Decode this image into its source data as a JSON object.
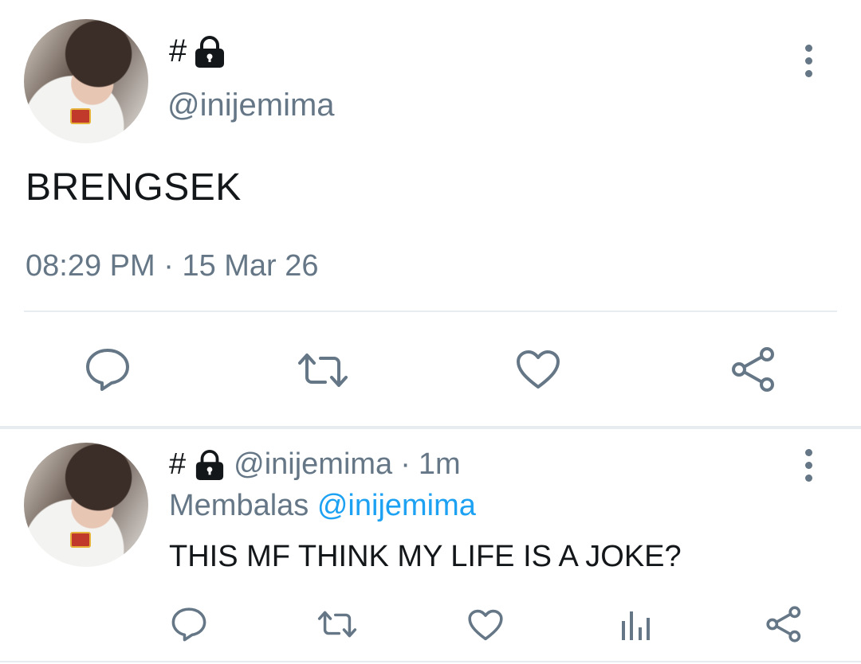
{
  "main_tweet": {
    "display_name": "#",
    "handle": "@inijemima",
    "text": "BRENGSEK",
    "time": "08:29 PM",
    "separator": "·",
    "date": "15 Mar 26"
  },
  "reply_tweet": {
    "display_name": "#",
    "handle": "@inijemima",
    "separator": "·",
    "time_ago": "1m",
    "replying_prefix": "Membalas",
    "replying_to": "@inijemima",
    "text": "THIS MF THINK MY LIFE IS A JOKE?"
  },
  "icons": {
    "lock": "lock-icon",
    "more": "more-vertical-icon",
    "reply": "reply-icon",
    "retweet": "retweet-icon",
    "like": "like-icon",
    "share": "share-icon",
    "analytics": "analytics-icon"
  },
  "colors": {
    "text": "#14171a",
    "secondary": "#657786",
    "link": "#1da1f2",
    "divider": "#e6ecf0"
  }
}
